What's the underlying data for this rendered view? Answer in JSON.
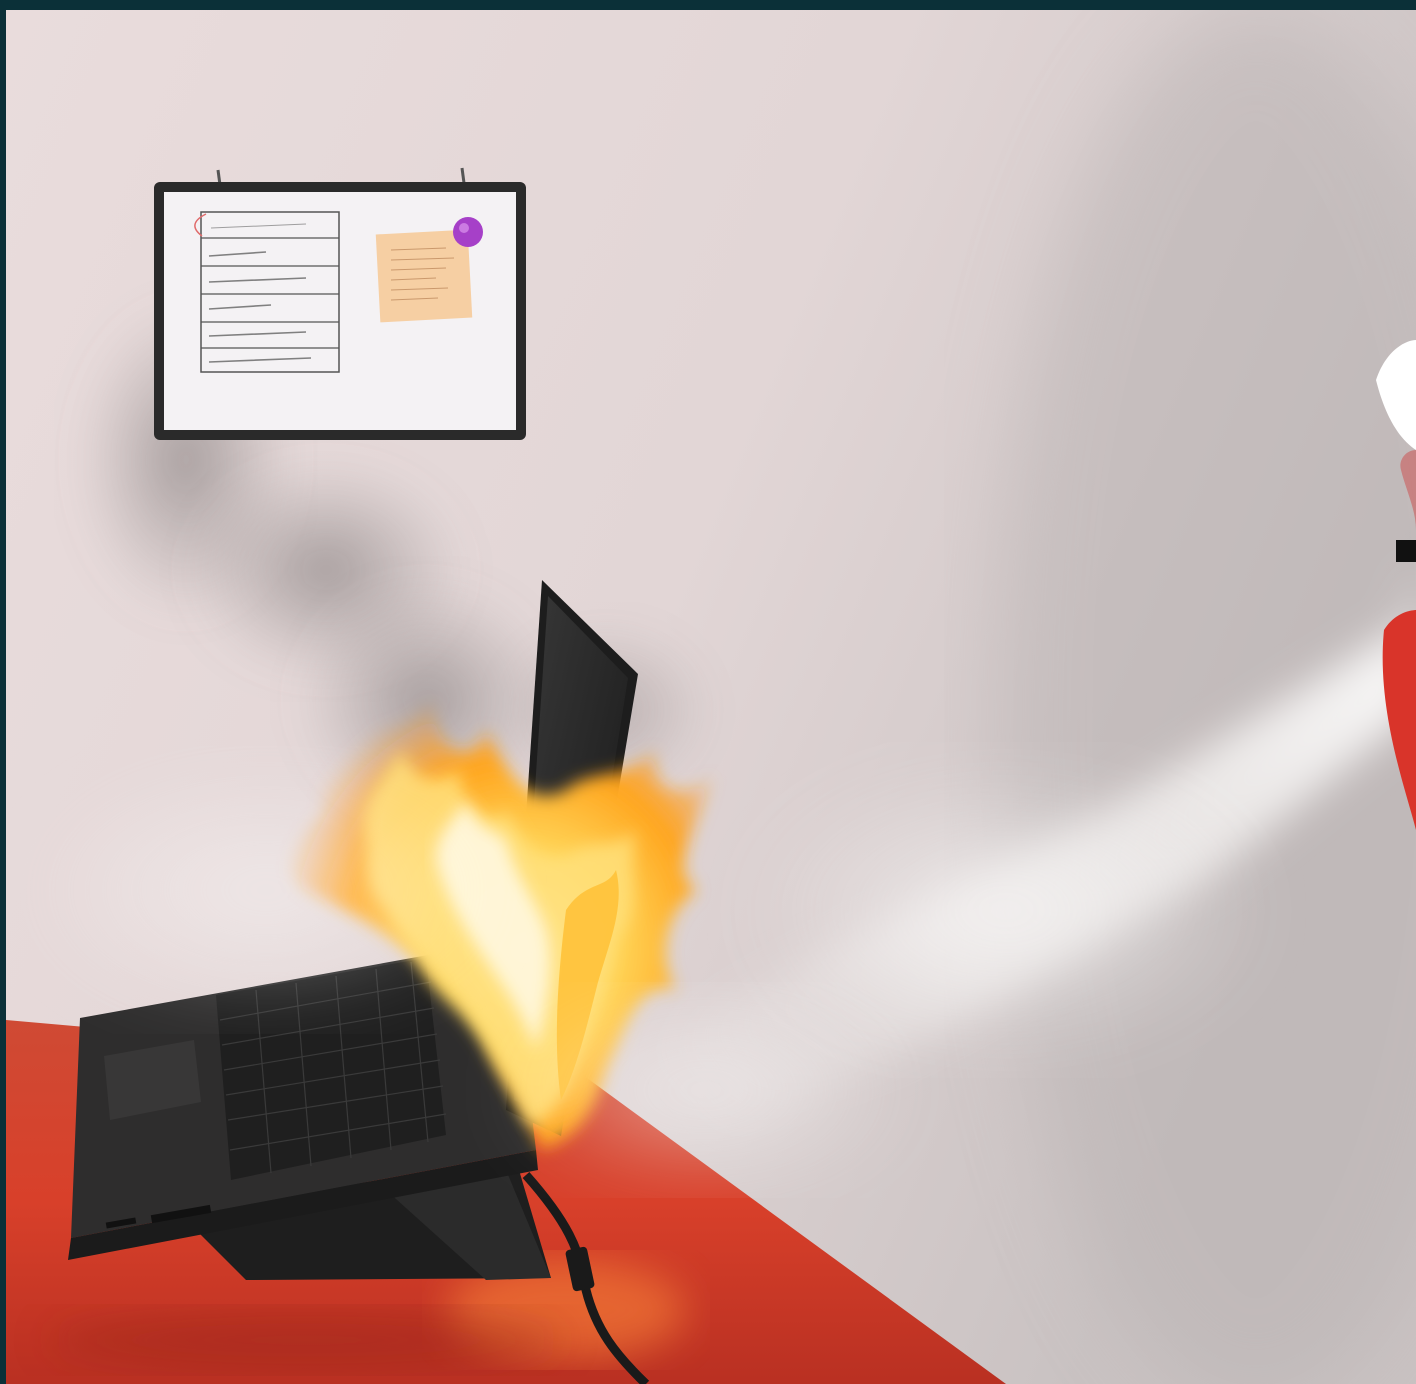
{
  "scene": {
    "colors": {
      "frame": "#0b3038",
      "wall": "#e6d9d9",
      "desk": "#d9432a",
      "laptop": "#2b2b2b",
      "flame": "#ffb428",
      "spray": "#f3f0ee",
      "extinguisher": "#d9342a",
      "magnet": "#a640c8",
      "sticky_note": "#f6cfa3"
    }
  }
}
